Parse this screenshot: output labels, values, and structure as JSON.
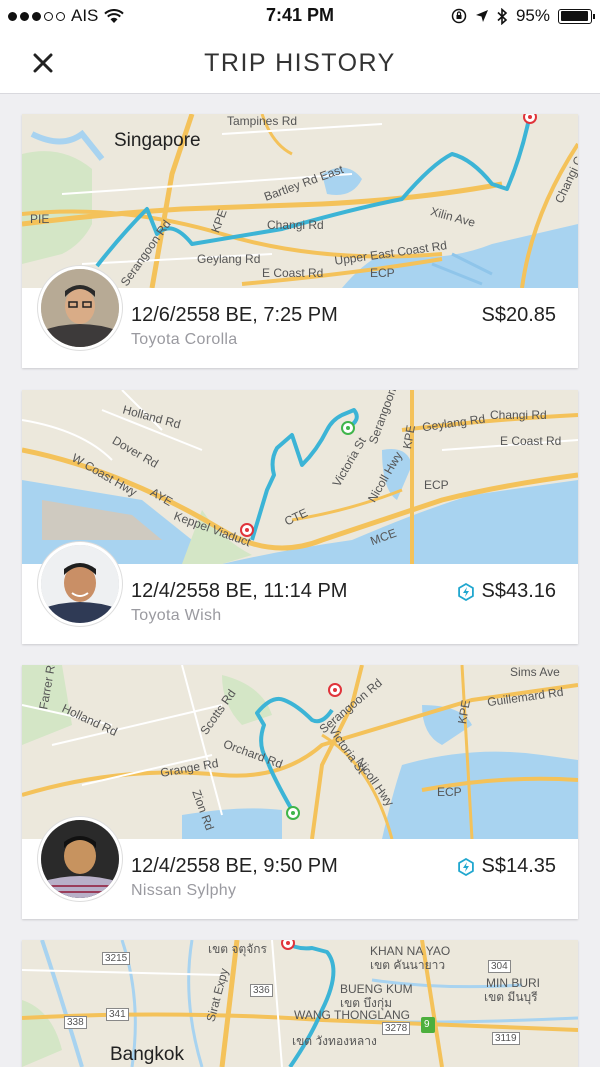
{
  "status_bar": {
    "carrier": "AIS",
    "time": "7:41 PM",
    "battery": "95%",
    "battery_level": 0.95
  },
  "header": {
    "title": "TRIP HISTORY",
    "close_icon": "close-icon"
  },
  "trips": [
    {
      "datetime": "12/6/2558 BE, 7:25 PM",
      "car": "Toyota Corolla",
      "fare": "S$20.85",
      "surge": false,
      "map_labels": [
        "Singapore",
        "Tampines Rd",
        "Bartley Rd East",
        "PIE",
        "KPE",
        "Serangoon Rd",
        "Changi Rd",
        "Geylang Rd",
        "Upper East Coast Rd",
        "E Coast Rd",
        "ECP",
        "Xilin Ave",
        "Changi Coast Rd"
      ]
    },
    {
      "datetime": "12/4/2558 BE, 11:14 PM",
      "car": "Toyota Wish",
      "fare": "S$43.16",
      "surge": true,
      "map_labels": [
        "Holland Rd",
        "Dover Rd",
        "W Coast Hwy",
        "AYE",
        "Keppel Viaduct",
        "CTE",
        "Serangoon Rd",
        "Victoria St",
        "Nicoll Hwy",
        "ECP",
        "MCE",
        "Geylang Rd",
        "Changi Rd",
        "E Coast Rd",
        "KPE"
      ]
    },
    {
      "datetime": "12/4/2558 BE, 9:50 PM",
      "car": "Nissan Sylphy",
      "fare": "S$14.35",
      "surge": true,
      "map_labels": [
        "Farrer Rd",
        "Holland Rd",
        "Scotts Rd",
        "Orchard Rd",
        "Grange Rd",
        "Zion Rd",
        "Serangoon Rd",
        "Victoria St",
        "Nicoll Hwy",
        "ECP",
        "Guillemard Rd",
        "Sims Ave",
        "KPE"
      ]
    },
    {
      "map_labels": [
        "เขต จตุจักร",
        "3215",
        "Sirat Expy",
        "336",
        "341",
        "338",
        "KHAN NA YAO",
        "เขต คันนายาว",
        "BUENG KUM",
        "เขต บึงกุ่ม",
        "WANG THONGLANG",
        "เขต วังทองหลาง",
        "3278",
        "9",
        "304",
        "MIN BURI",
        "เขต มีนบุรี",
        "3119",
        "Bangkok"
      ]
    }
  ],
  "colors": {
    "route": "#3cb4d6",
    "pickup": "#3fb54a",
    "dropoff": "#e0343b",
    "surge": "#21a7cf"
  }
}
